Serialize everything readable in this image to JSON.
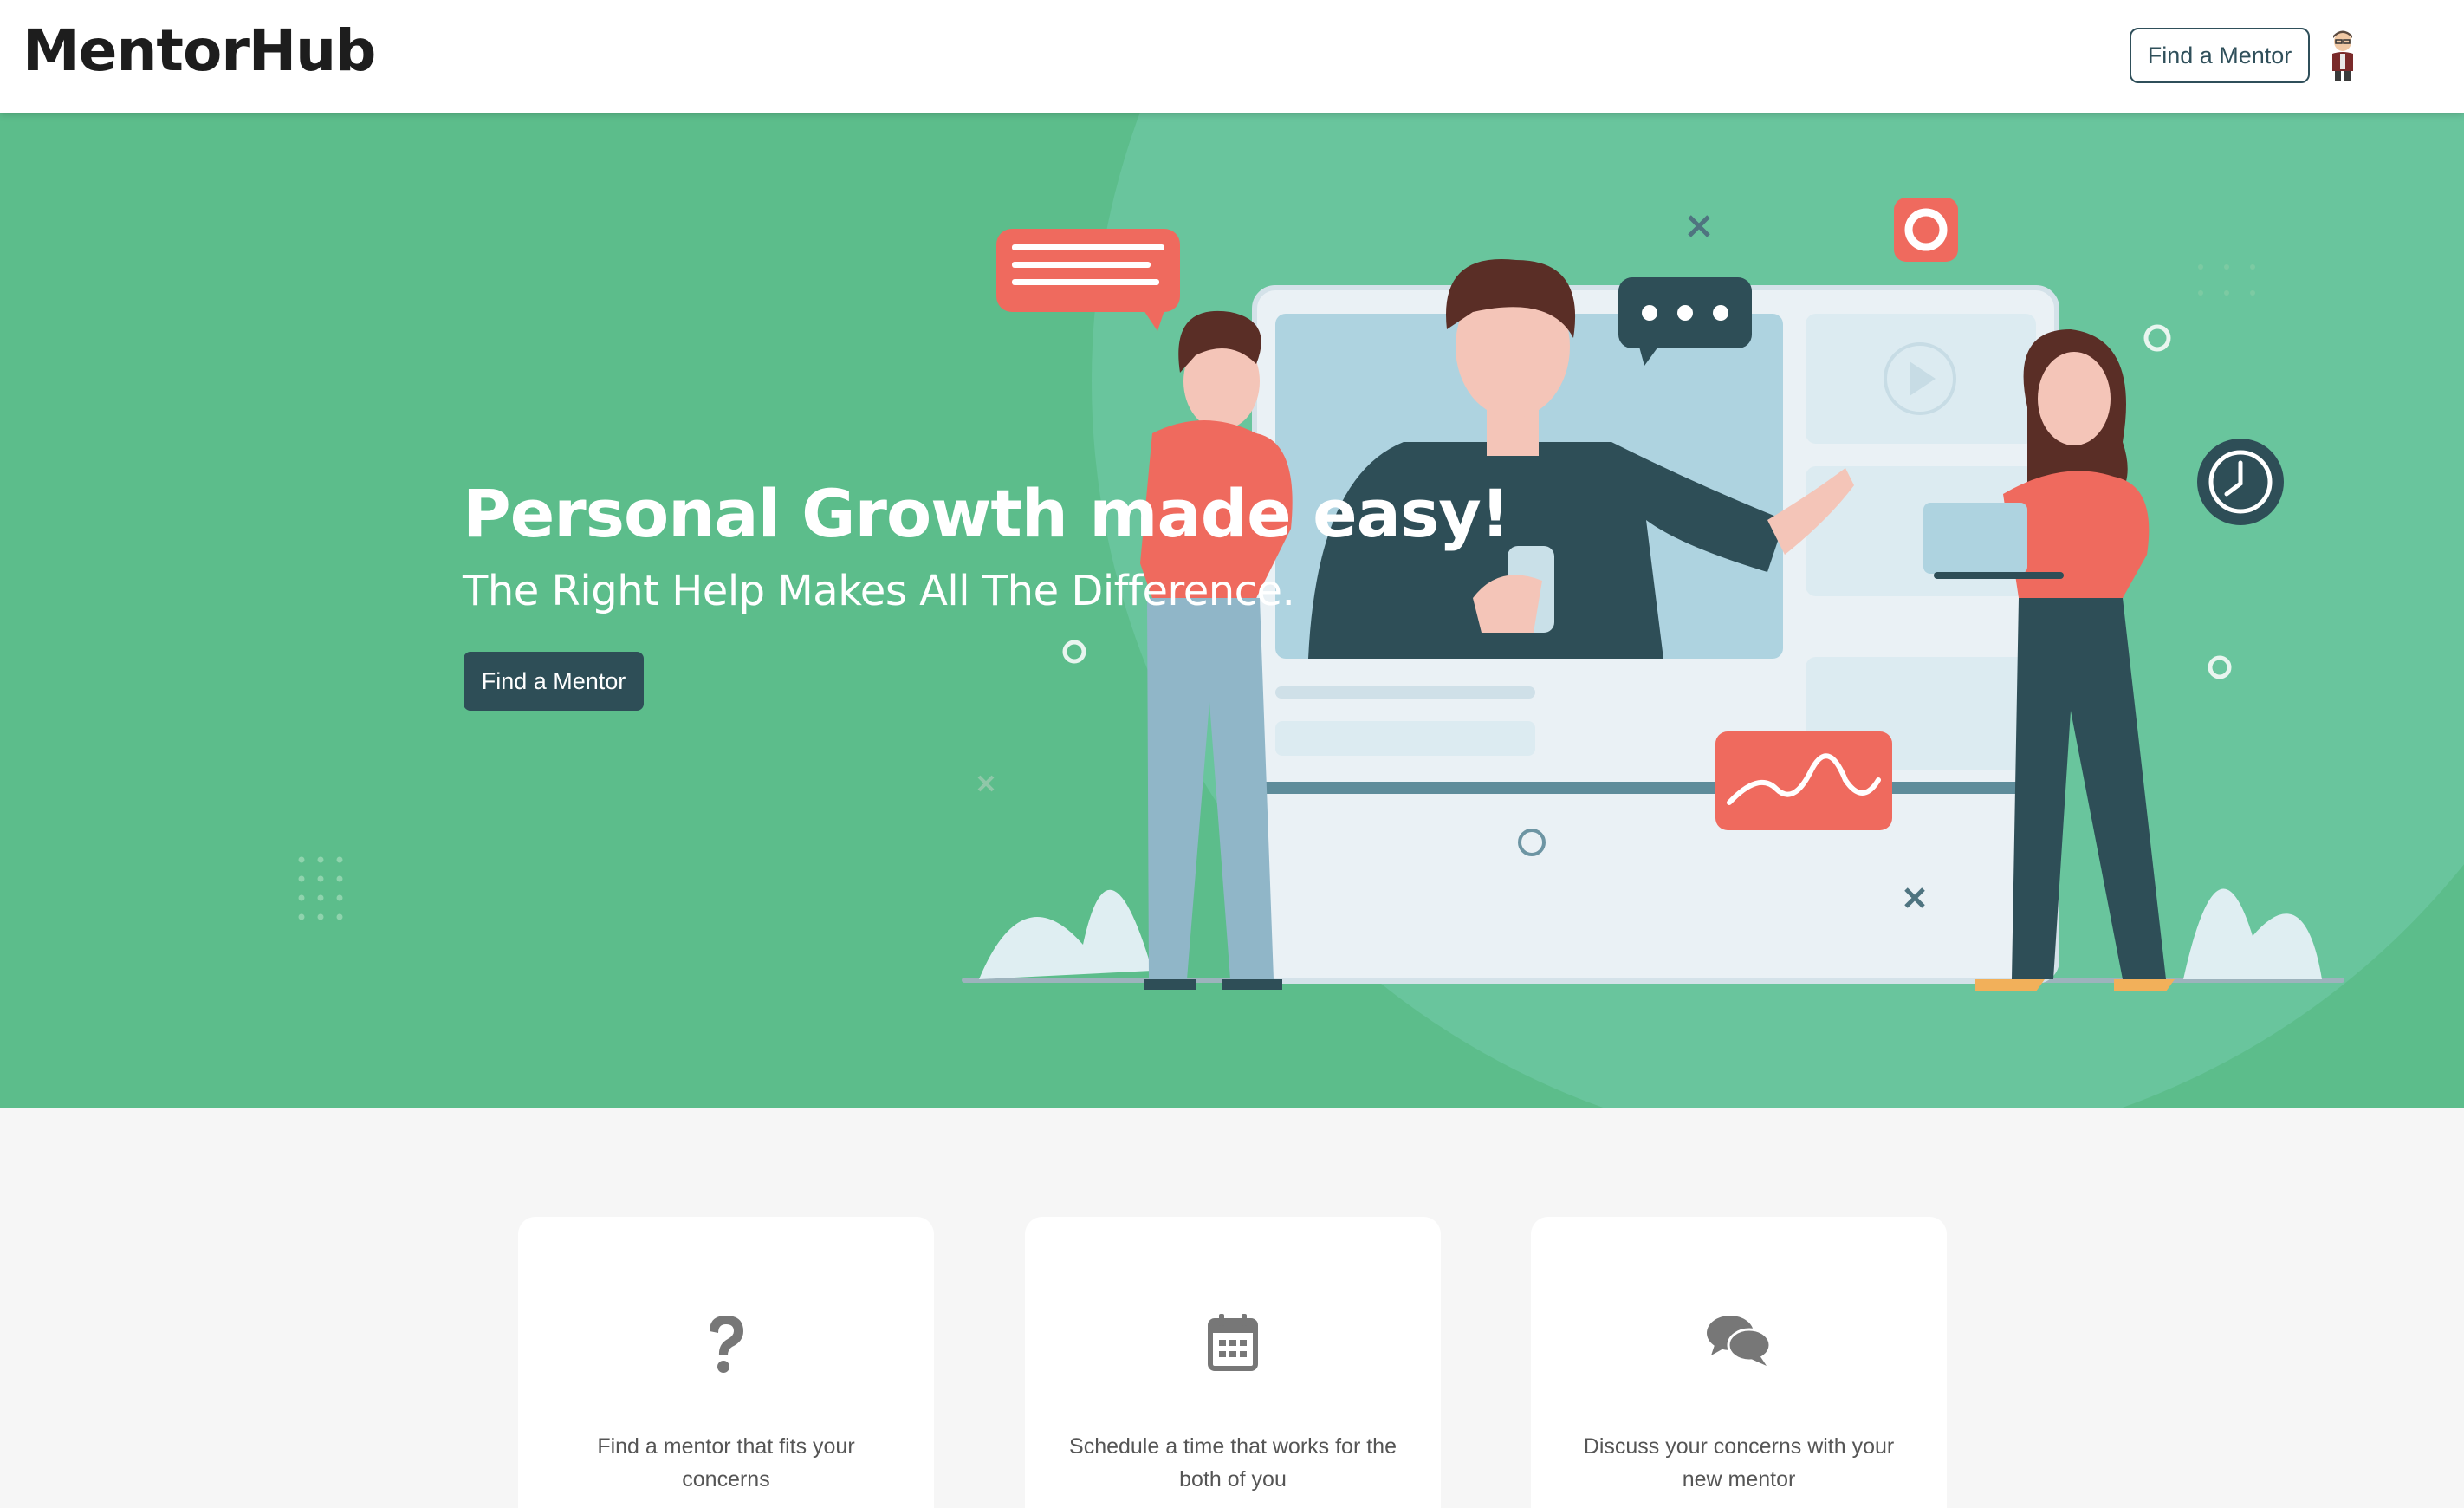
{
  "header": {
    "logo": "MentorHub",
    "find_mentor_label": "Find a Mentor",
    "avatar_icon": "user-avatar-icon"
  },
  "hero": {
    "title": "Personal Growth made easy!",
    "subtitle": "The Right Help Makes All The Difference.",
    "cta_label": "Find a Mentor",
    "background_color": "#5cbd8b",
    "illustration": "video-mentoring-illustration"
  },
  "features": [
    {
      "icon": "question-mark-icon",
      "text": "Find a mentor that fits your concerns"
    },
    {
      "icon": "calendar-icon",
      "text": "Schedule a time that works for the both of you"
    },
    {
      "icon": "chat-bubbles-icon",
      "text": "Discuss your concerns with your new mentor"
    }
  ],
  "colors": {
    "dark_teal": "#2e4e57",
    "accent_red": "#ef6a5e",
    "icon_gray": "#777777"
  }
}
